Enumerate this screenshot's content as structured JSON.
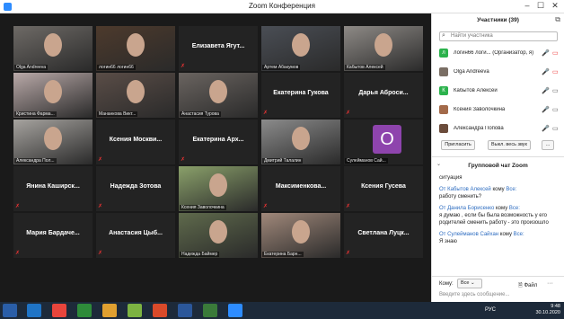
{
  "window": {
    "title": "Zoom Конференция"
  },
  "tiles": [
    {
      "name": "Olga Andreeva",
      "label": "Olga Andreeva",
      "video": true,
      "speaking": true
    },
    {
      "name": "логин66 логин66",
      "label": "логин66 логин66",
      "video": true
    },
    {
      "name": "Елизавета Ягут...",
      "label": "",
      "video": false
    },
    {
      "name": "Артем Абакумов",
      "label": "Артем Абакумов",
      "video": true
    },
    {
      "name": "Кабытов Алексей",
      "label": "Кабытов Алексей",
      "video": true
    },
    {
      "name": "Кристина Фарма...",
      "label": "Кристина Фарма...",
      "video": true
    },
    {
      "name": "Мананкова Викт...",
      "label": "Мананкова Викт...",
      "video": true
    },
    {
      "name": "Анастасия Турова",
      "label": "Анастасия Турова",
      "video": true
    },
    {
      "name": "Екатерина Гукова",
      "label": "",
      "video": false
    },
    {
      "name": "Дарья Аброси...",
      "label": "",
      "video": false
    },
    {
      "name": "Александра Пол...",
      "label": "Александра Пол...",
      "video": true
    },
    {
      "name": "Ксения Москви...",
      "label": "",
      "video": false
    },
    {
      "name": "Екатерина Арх...",
      "label": "",
      "video": false
    },
    {
      "name": "Дмитрий Талалин",
      "label": "Дмитрий Талалин",
      "video": true
    },
    {
      "name": "Сулейманов Сай...",
      "label": "Сулейманов Сай...",
      "video": false,
      "avatar": "O"
    },
    {
      "name": "Янина Каширск...",
      "label": "",
      "video": false
    },
    {
      "name": "Надежда Зотова",
      "label": "",
      "video": false
    },
    {
      "name": "Ксения Заволочкина",
      "label": "Ксения Заволочкина",
      "video": true
    },
    {
      "name": "Максименкова...",
      "label": "",
      "video": false
    },
    {
      "name": "Ксения Гусева",
      "label": "",
      "video": false
    },
    {
      "name": "Мария Бардаче...",
      "label": "",
      "video": false
    },
    {
      "name": "Анастасия Цыб...",
      "label": "",
      "video": false
    },
    {
      "name": "Надежда Баймер",
      "label": "Надежда Баймер",
      "video": true
    },
    {
      "name": "Екатерина Барн...",
      "label": "Екатерина Барн...",
      "video": true
    },
    {
      "name": "Светлана Луцк...",
      "label": "",
      "video": false
    }
  ],
  "participants": {
    "header": "Участники (39)",
    "search_placeholder": "Найти участника",
    "list": [
      {
        "initial": "л",
        "color": "#2bb24c",
        "name": "логин66 логи... (Организатор, я)"
      },
      {
        "initial": "",
        "color": "#7a6e64",
        "name": "Olga Andreeva"
      },
      {
        "initial": "К",
        "color": "#2bb24c",
        "name": "Кабытов Алексей"
      },
      {
        "initial": "",
        "color": "#a36a4a",
        "name": "Ксения Заволочкина"
      },
      {
        "initial": "",
        "color": "#6b4c3b",
        "name": "Александра Попова"
      }
    ],
    "invite": "Пригласить",
    "mute_all": "Выкл. весь звук",
    "more": "..."
  },
  "chat": {
    "header": "Групповой чат Zoom",
    "messages": [
      {
        "text": "ситуация"
      },
      {
        "from": "От Кабытов Алексей",
        "to": "кому",
        "to_target": "Все:",
        "text": "работу сменить?"
      },
      {
        "from": "От Данила Борисенко",
        "to": "кому",
        "to_target": "Все:",
        "text": "я думаю , если бы была возможность у его родителей сменить работу - это произошло"
      },
      {
        "from": "От Сулейманов Сайхан",
        "to": "кому",
        "to_target": "Все:",
        "text": "Я знаю"
      }
    ],
    "to_label": "Кому:",
    "to_value": "Все",
    "file_label": "Файл",
    "input_placeholder": "Введите здесь сообщение..."
  },
  "taskbar": {
    "lang": "РУС",
    "time": "9:48",
    "date": "30.10.2020"
  }
}
